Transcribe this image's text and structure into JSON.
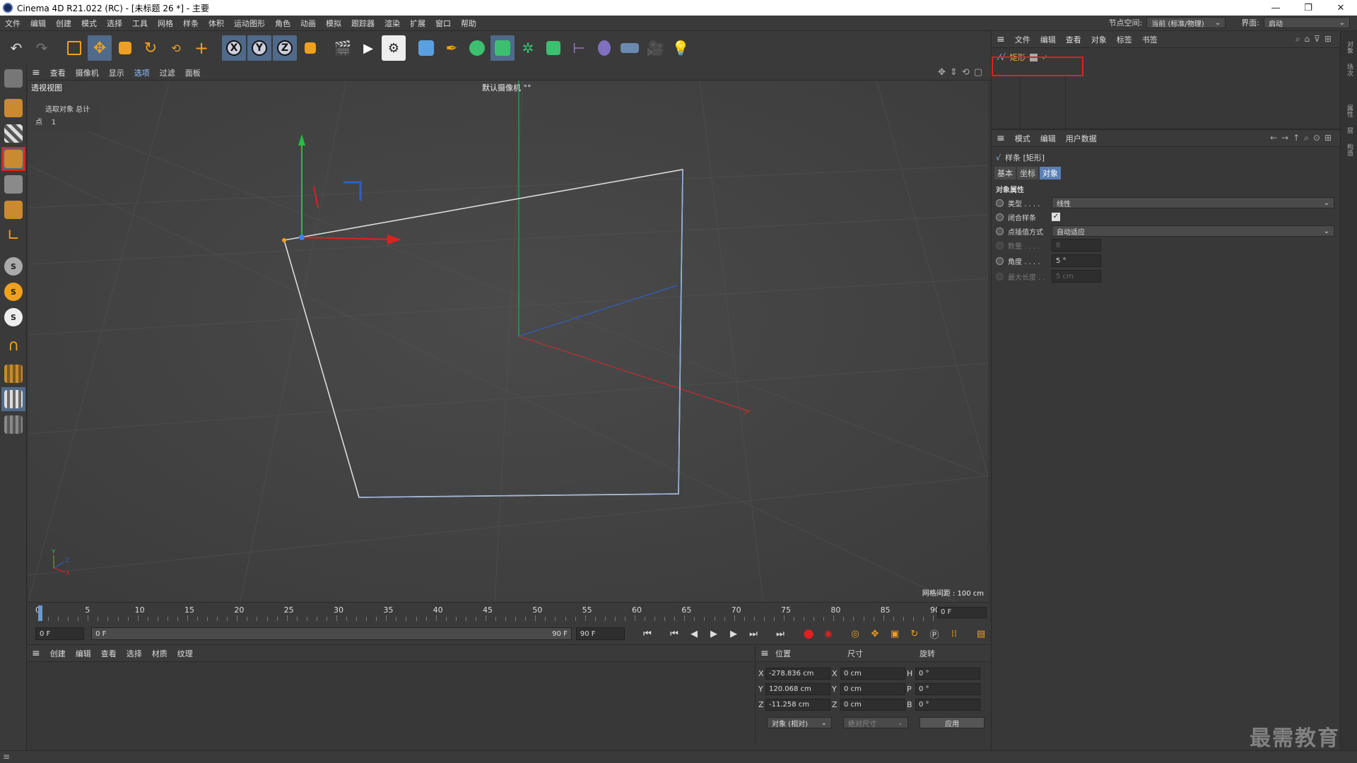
{
  "window": {
    "title": "Cinema 4D R21.022 (RC) - [未标题 26 *] - 主要",
    "controls": [
      "—",
      "❐",
      "✕"
    ]
  },
  "menu": [
    "文件",
    "编辑",
    "创建",
    "模式",
    "选择",
    "工具",
    "网格",
    "样条",
    "体积",
    "运动图形",
    "角色",
    "动画",
    "模拟",
    "跟踪器",
    "渲染",
    "扩展",
    "窗口",
    "帮助"
  ],
  "node_space": {
    "label": "节点空间:",
    "value": "当前 (标准/物理)"
  },
  "layout": {
    "label": "界面:",
    "value": "启动"
  },
  "viewport": {
    "menu": [
      "查看",
      "摄像机",
      "显示",
      "选项",
      "过滤",
      "面板"
    ],
    "active_menu": "选项",
    "view_name": "透视视图",
    "camera": "默认摄像机 °°",
    "hud_header": "选取对象 总计",
    "hud_row_label": "点",
    "hud_row_value": "1",
    "grid_spacing": "网格间距 : 100 cm"
  },
  "timeline": {
    "ticks": [
      "0",
      "5",
      "10",
      "15",
      "20",
      "25",
      "30",
      "35",
      "40",
      "45",
      "50",
      "55",
      "60",
      "65",
      "70",
      "75",
      "80",
      "85",
      "90"
    ],
    "current": "0 F"
  },
  "playbar": {
    "start": "0 F",
    "range_start": "0 F",
    "range_end": "90 F",
    "end": "90 F"
  },
  "material_menu": [
    "创建",
    "编辑",
    "查看",
    "选择",
    "材质",
    "纹理"
  ],
  "coords": {
    "headers": {
      "pos": "位置",
      "size": "尺寸",
      "rot": "旋转"
    },
    "rows": [
      {
        "axis": "X",
        "pos": "-278.836 cm",
        "saxis": "X",
        "size": "0 cm",
        "raxis": "H",
        "rot": "0 °"
      },
      {
        "axis": "Y",
        "pos": "120.068 cm",
        "saxis": "Y",
        "size": "0 cm",
        "raxis": "P",
        "rot": "0 °"
      },
      {
        "axis": "Z",
        "pos": "-11.258 cm",
        "saxis": "Z",
        "size": "0 cm",
        "raxis": "B",
        "rot": "0 °"
      }
    ],
    "mode": "对象 (相对)",
    "size_mode": "绝对尺寸",
    "apply": "应用"
  },
  "object_manager": {
    "menu": [
      "文件",
      "编辑",
      "查看",
      "对象",
      "标签",
      "书签"
    ],
    "object_name": "矩形"
  },
  "attributes": {
    "menu": [
      "模式",
      "编辑",
      "用户数据"
    ],
    "object_title": "样条 [矩形]",
    "tabs": [
      "基本",
      "坐标",
      "对象"
    ],
    "active_tab": "对象",
    "section": "对象属性",
    "rows": [
      {
        "label": "类型 . . . .",
        "value": "线性"
      },
      {
        "label": "闭合样条",
        "value": "✓"
      },
      {
        "label": "点插值方式",
        "value": "自动适应"
      },
      {
        "label": "数量 . . . .",
        "value": "8"
      },
      {
        "label": "角度 . . . .",
        "value": "5 °"
      },
      {
        "label": "最大长度 . .",
        "value": "5 cm"
      }
    ]
  },
  "side_tabs": [
    "对象",
    "场次",
    "属性",
    "层",
    "构造"
  ],
  "watermark": "最需教育"
}
